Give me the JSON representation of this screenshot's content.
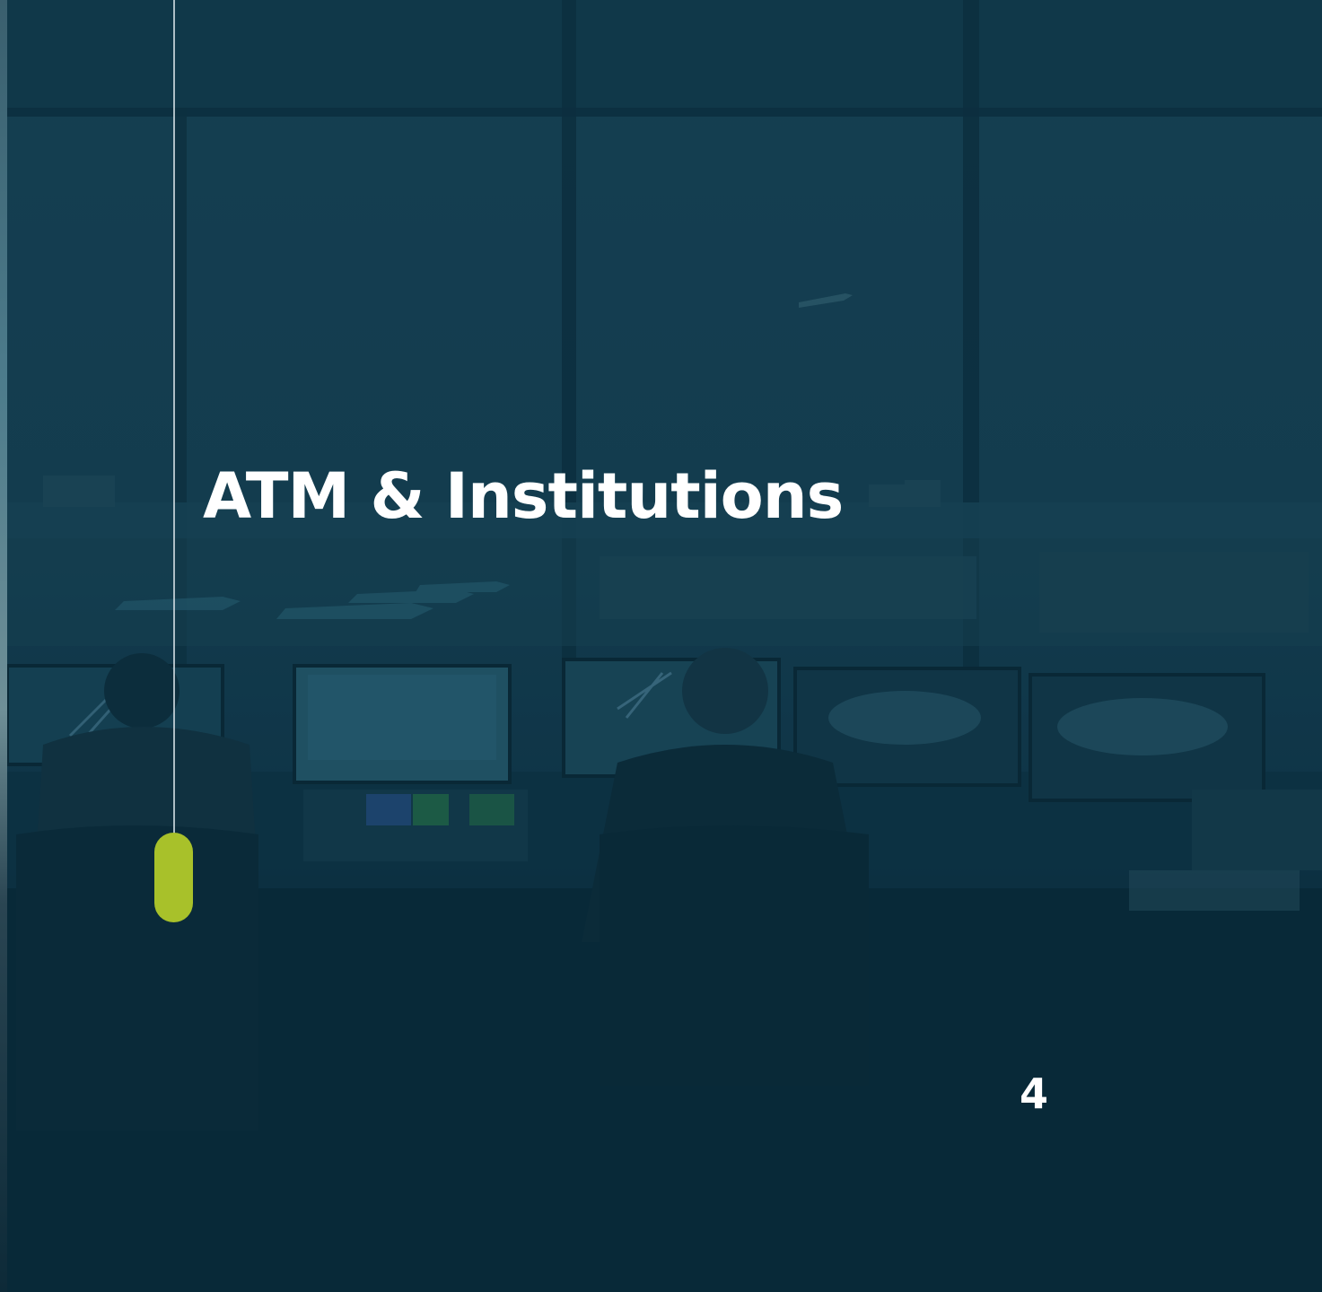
{
  "slide": {
    "title": "ATM & Institutions",
    "page_number": "4"
  },
  "colors": {
    "overlay": "#0a2a3a",
    "accent": "#a8c12a",
    "text": "#ffffff"
  },
  "background_image": {
    "subject": "air traffic control tower interior with controllers at radar and world-map displays, aircraft on apron outside windows"
  }
}
